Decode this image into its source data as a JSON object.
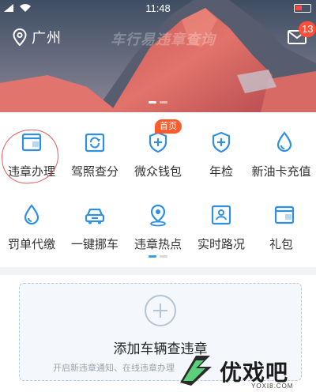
{
  "status": {
    "time": "11:48"
  },
  "header": {
    "city": "广州",
    "banner_text": "车行易违章查询",
    "unread_count": "13"
  },
  "menu": {
    "row1": [
      {
        "label": "违章办理",
        "icon": "violation-card-icon"
      },
      {
        "label": "驾照查分",
        "icon": "license-refresh-icon"
      },
      {
        "label": "微众钱包",
        "icon": "wallet-shield-icon",
        "badge": "首页"
      },
      {
        "label": "年检",
        "icon": "inspection-shield-icon"
      },
      {
        "label": "新油卡充值",
        "icon": "fuel-drop-icon"
      }
    ],
    "row2": [
      {
        "label": "罚单代缴",
        "icon": "fine-drop-icon"
      },
      {
        "label": "一键挪车",
        "icon": "car-move-icon"
      },
      {
        "label": "违章热点",
        "icon": "hotspot-pin-icon"
      },
      {
        "label": "实时路况",
        "icon": "road-condition-icon"
      },
      {
        "label": "礼包",
        "icon": "gift-card-icon"
      }
    ]
  },
  "add_vehicle": {
    "title": "添加车辆查违章",
    "subtitle": "开启新违章通知、在线违章办理"
  },
  "watermark": {
    "name": "优戏吧",
    "url": "YOXI8.COM"
  },
  "colors": {
    "accent": "#3b9fe6",
    "badge": "#ff5a2a",
    "mail_badge": "#ff4e3a"
  }
}
